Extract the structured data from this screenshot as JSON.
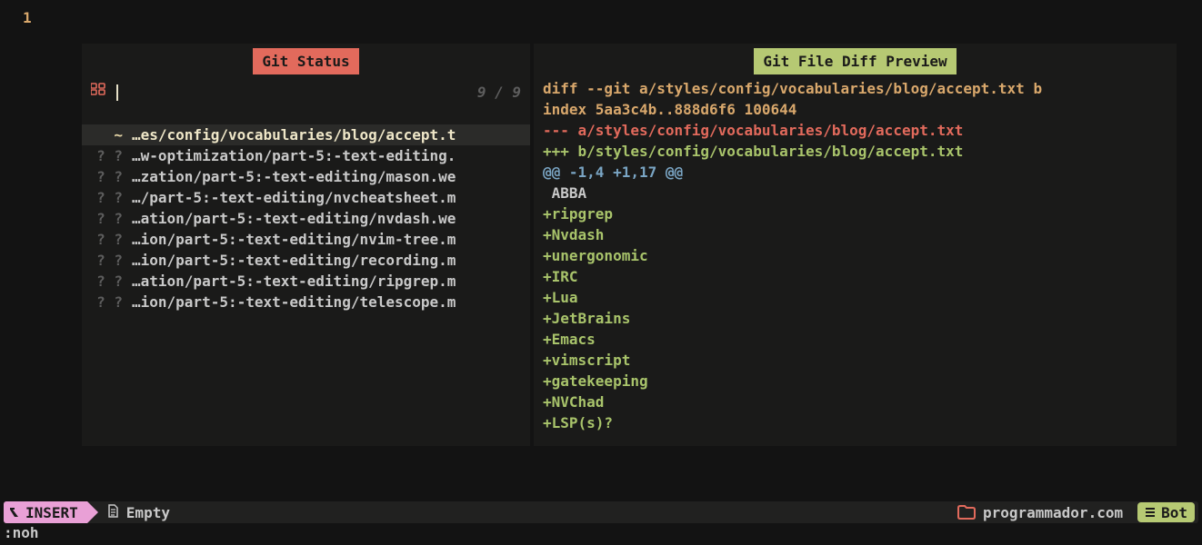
{
  "gutter": {
    "lineNumber": "1"
  },
  "leftPanel": {
    "title": "Git Status",
    "search": {
      "count": "9 / 9"
    },
    "files": [
      {
        "status": "~",
        "name": "…es/config/vocabularies/blog/accept.t",
        "selected": true
      },
      {
        "status": "? ?",
        "name": "…w-optimization/part-5:-text-editing."
      },
      {
        "status": "? ?",
        "name": "…zation/part-5:-text-editing/mason.we"
      },
      {
        "status": "? ?",
        "name": "…/part-5:-text-editing/nvcheatsheet.m"
      },
      {
        "status": "? ?",
        "name": "…ation/part-5:-text-editing/nvdash.we"
      },
      {
        "status": "? ?",
        "name": "…ion/part-5:-text-editing/nvim-tree.m"
      },
      {
        "status": "? ?",
        "name": "…ion/part-5:-text-editing/recording.m"
      },
      {
        "status": "? ?",
        "name": "…ation/part-5:-text-editing/ripgrep.m"
      },
      {
        "status": "? ?",
        "name": "…ion/part-5:-text-editing/telescope.m"
      }
    ]
  },
  "rightPanel": {
    "title": "Git File Diff Preview",
    "lines": [
      {
        "cls": "d-header",
        "text": "diff --git a/styles/config/vocabularies/blog/accept.txt b"
      },
      {
        "cls": "d-header",
        "text": "index 5aa3c4b..888d6f6 100644"
      },
      {
        "cls": "d-minusfile",
        "text": "--- a/styles/config/vocabularies/blog/accept.txt"
      },
      {
        "cls": "d-plusfile",
        "text": "+++ b/styles/config/vocabularies/blog/accept.txt"
      },
      {
        "cls": "d-hunk",
        "text": "@@ -1,4 +1,17 @@"
      },
      {
        "cls": "d-ctx",
        "text": " ABBA"
      },
      {
        "cls": "d-add",
        "text": "+ripgrep"
      },
      {
        "cls": "d-add",
        "text": "+Nvdash"
      },
      {
        "cls": "d-add",
        "text": "+unergonomic"
      },
      {
        "cls": "d-add",
        "text": "+IRC"
      },
      {
        "cls": "d-add",
        "text": "+Lua"
      },
      {
        "cls": "d-add",
        "text": "+JetBrains"
      },
      {
        "cls": "d-add",
        "text": "+Emacs"
      },
      {
        "cls": "d-add",
        "text": "+vimscript"
      },
      {
        "cls": "d-add",
        "text": "+gatekeeping"
      },
      {
        "cls": "d-add",
        "text": "+NVChad"
      },
      {
        "cls": "d-add",
        "text": "+LSP(s)?"
      }
    ]
  },
  "status": {
    "mode": "INSERT",
    "fileLabel": "Empty",
    "folderLabel": "programmador.com",
    "position": "Bot"
  },
  "cmdline": ":noh"
}
